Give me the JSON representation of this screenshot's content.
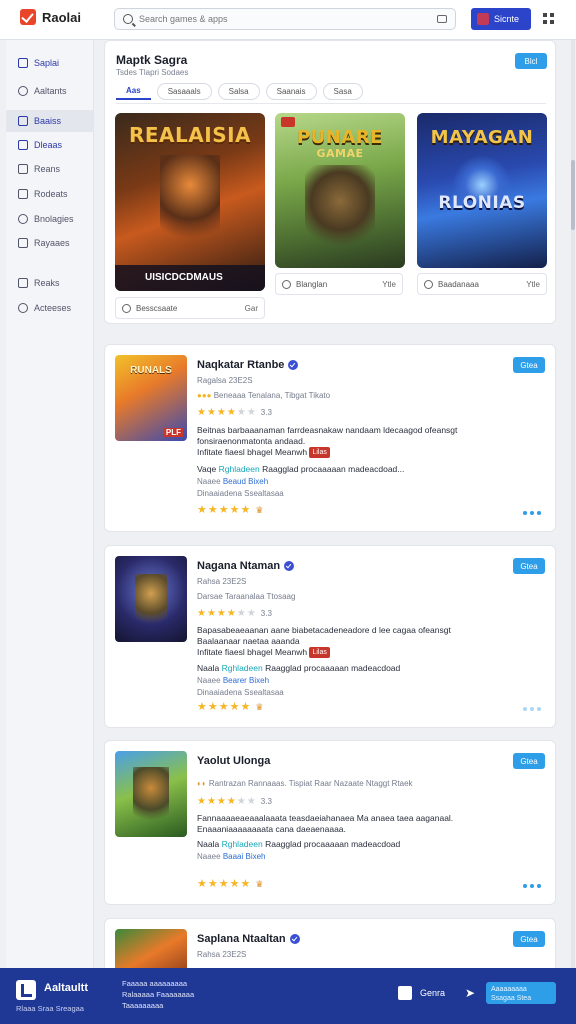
{
  "app": {
    "name": "Raolai"
  },
  "search": {
    "placeholder": "Search games & apps"
  },
  "header": {
    "signin_label": "Sicnte"
  },
  "sidebar": {
    "items": [
      {
        "label": "Saplai"
      },
      {
        "label": "Aaltants"
      },
      {
        "label": "Baaiss"
      },
      {
        "label": "Dleaas"
      },
      {
        "label": "Reans"
      },
      {
        "label": "Rodeats"
      },
      {
        "label": "Bnolagies"
      },
      {
        "label": "Rayaaes"
      },
      {
        "label": "Reaks"
      },
      {
        "label": "Acteeses"
      }
    ]
  },
  "featured": {
    "title": "Maptk Sagra",
    "subtitle": "Tsdes Tlapri Sodaes",
    "button": "Blcl",
    "tabs": [
      "Aas",
      "Sasaaals",
      "Salsa",
      "Saanais",
      "Sasa"
    ],
    "cards": [
      {
        "art_title": "REALAISIA",
        "caption": "UISICDCDMAUS",
        "strip_label": "Besscsaate",
        "strip_action": "Gar"
      },
      {
        "art_title": "PUNARE",
        "art_sub": "GAMAE",
        "strip_label": "Blanglan",
        "strip_action": "Ytle"
      },
      {
        "art_title": "MAYAGAN",
        "art_sub": "RLONIAS",
        "strip_label": "Baadanaaa",
        "strip_action": "Ytle"
      }
    ]
  },
  "games": [
    {
      "name": "Naqkatar Rtanbe",
      "meta": "Ragalsa 23E2S",
      "stars_on": 4,
      "stars_off": 2,
      "review_count": "3.3",
      "developer": "Beneaaa Tenalana, Tibgat Tikato",
      "desc_1": "Beitnas barbaaanaman farrdeasnakaw nandaam ldecaagod ofeansgt",
      "desc_2": "fonsiraenonmatonta andaad.",
      "desc_3": "Infitate fiaesl bhagel Meanwh",
      "chip": "Lilas",
      "tags_label": "Vaqe",
      "tags_hl": "Rghladeen",
      "tags_rest": "Raagglad procaaaaan madeacdoad...",
      "link_label": "Naaee",
      "link": "Beaud Bixeh",
      "extra": "Dinaaiadena Ssealtasaa",
      "rating_stars": 5,
      "thumb_text": "RUNALS",
      "thumb_badge": "PLF"
    },
    {
      "name": "Nagana Ntaman",
      "meta": "Rahsa 23E2S",
      "stars_on": 4,
      "stars_off": 2,
      "review_count": "3.3",
      "developer": "Darsae Taraanalaa Ttosaag",
      "desc_1": "Bapasabeaeaanan aane biabetacadeneadore d lee cagaa ofeansgt",
      "desc_2": "Baalaanaar naetaa aaanda",
      "desc_3": "Infitate fiaesl bhagel Meanwh",
      "chip": "Lilas",
      "tags_label": "Naala",
      "tags_hl": "Rghladeen",
      "tags_rest": "Raagglad procaaaaan madeacdoad",
      "link_label": "Naaee",
      "link": "Bearer Bixeh",
      "extra": "Dinaaiadena Ssealtasaa",
      "rating_stars": 5,
      "thumb_text": "",
      "thumb_badge": ""
    },
    {
      "name": "Yaolut Ulonga",
      "meta": "Rantrazan Rannaaas. Tispiat Raar Nazaate Ntaggt Rtaek",
      "stars_on": 4,
      "stars_off": 2,
      "review_count": "3.3",
      "developer": "",
      "desc_1": "Fannaaaaeaeaaalaaata teasdaeiahanaea Ma anaea taea aaganaal.",
      "desc_2": "Enaaaniaaaaaaaata cana daeaenaaaa.",
      "desc_3": "",
      "chip": "",
      "tags_label": "Naala",
      "tags_hl": "Rghladeen",
      "tags_rest": "Raagglad procaaaaan madeacdoad",
      "link_label": "Naaee",
      "link": "Baaai Bixeh",
      "extra": "",
      "rating_stars": 5,
      "thumb_text": "",
      "thumb_badge": ""
    },
    {
      "name": "Saplana Ntaaltan",
      "meta": "Rahsa 23E2S",
      "stars_on": 0,
      "stars_off": 0,
      "review_count": "",
      "developer": "",
      "desc_1": "",
      "desc_2": "",
      "desc_3": "",
      "chip": "",
      "tags_label": "",
      "tags_hl": "",
      "tags_rest": "",
      "link_label": "",
      "link": "",
      "extra": "",
      "rating_stars": 0,
      "thumb_text": "",
      "thumb_badge": ""
    }
  ],
  "card_button": "Gtea",
  "footer": {
    "brand": "Aaltaultt",
    "sub": "Rlaaa Sraa Sreagaa",
    "text_1": "Faaaaa aaaaaaaaa",
    "text_2": "Ralaaaaa Faaaaaaaa",
    "text_3": "Taaaaaaaaa",
    "user_label": "Genra",
    "input_text": "Aaaaaaaaa Ssagaa Stea"
  },
  "colors": {
    "primary": "#2b44c9",
    "accent": "#2f9ee8",
    "star": "#f5b623",
    "footer": "#1f3795"
  }
}
